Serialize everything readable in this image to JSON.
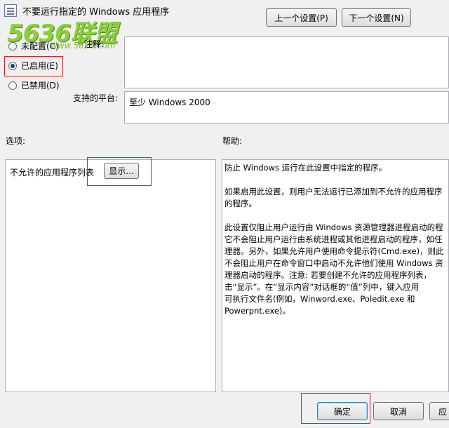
{
  "window": {
    "title": "不要运行指定的 Windows 应用程序"
  },
  "watermark": {
    "logo": "5636联盟",
    "url": "www.5636.com"
  },
  "nav": {
    "prev_label": "上一个设置(P)",
    "next_label": "下一个设置(N)"
  },
  "state": {
    "options": [
      {
        "label": "未配置(C)",
        "selected": false
      },
      {
        "label": "已启用(E)",
        "selected": true
      },
      {
        "label": "已禁用(D)",
        "selected": false
      }
    ]
  },
  "comment": {
    "label": "注释:",
    "value": ""
  },
  "platform": {
    "label": "支持的平台:",
    "value": "至少 Windows 2000"
  },
  "options_section": {
    "label": "选项:",
    "item_label": "不允许的应用程序列表",
    "show_button": "显示..."
  },
  "help_section": {
    "label": "帮助:",
    "lines": [
      "防止 Windows 运行在此设置中指定的程序。",
      "",
      "如果启用此设置，则用户无法运行已添加到不允许的应用程序",
      "的程序。",
      "",
      "此设置仅阻止用户运行由 Windows 资源管理器进程启动的程",
      "它不会阻止用户运行由系统进程或其他进程启动的程序，如任",
      "理器。另外，如果允许用户使用命令提示符(Cmd.exe)，则此",
      "不会阻止用户在命令窗口中启动不允许他们使用 Windows 资",
      "理器启动的程序。注意: 若要创建不允许的应用程序列表，",
      "击“显示”。在“显示内容”对话框的“值”列中，键入应用",
      "可执行文件名(例如，Winword.exe、Poledit.exe 和",
      "Powerpnt.exe)。"
    ]
  },
  "footer": {
    "ok_label": "确定",
    "cancel_label": "取消",
    "apply_label": "应"
  },
  "colors": {
    "highlight_box": "#e02020",
    "watermark": "#8ccf3c"
  }
}
